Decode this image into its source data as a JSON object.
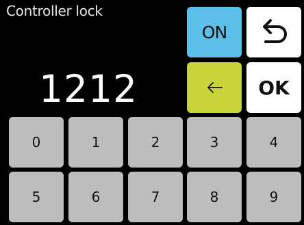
{
  "header": {
    "title": "Controller lock"
  },
  "display": {
    "code": "1212"
  },
  "actions": {
    "on_label": "ON",
    "ok_label": "OK",
    "back_icon": "undo-arrow-icon",
    "backspace_icon": "left-arrow-icon"
  },
  "keypad": {
    "row1": [
      "0",
      "1",
      "2",
      "3",
      "4"
    ],
    "row2": [
      "5",
      "6",
      "7",
      "8",
      "9"
    ]
  },
  "colors": {
    "background": "#000000",
    "on_button": "#5bbfea",
    "backspace_button": "#c9d33a",
    "key": "#bdbdbd",
    "white_button": "#ffffff"
  }
}
